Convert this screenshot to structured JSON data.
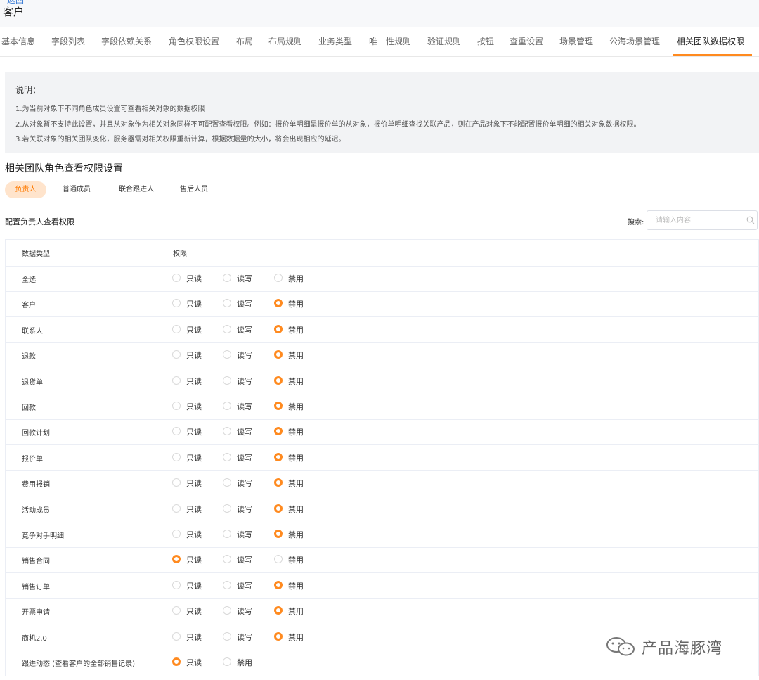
{
  "header": {
    "breadcrumb": "返回",
    "title": "客户"
  },
  "tabs": [
    "基本信息",
    "字段列表",
    "字段依赖关系",
    "角色权限设置",
    "布局",
    "布局规则",
    "业务类型",
    "唯一性规则",
    "验证规则",
    "按钮",
    "查重设置",
    "场景管理",
    "公海场景管理",
    "相关团队数据权限"
  ],
  "active_tab": "相关团队数据权限",
  "note": {
    "title": "说明：",
    "lines": [
      "1.为当前对象下不同角色成员设置可查看相关对象的数据权限",
      "2.从对象暂不支持此设置，并且从对象作为相关对象同样不可配置查看权限。例如：报价单明细是报价单的从对象，报价单明细查找关联产品，则在产品对象下不能配置报价单明细的相关对象数据权限。",
      "3.若关联对象的相关团队变化，服务器需对相关权限重新计算，根据数据量的大小，将会出现相应的延迟。"
    ]
  },
  "section_title": "相关团队角色查看权限设置",
  "role_tabs": [
    "负责人",
    "普通成员",
    "联合跟进人",
    "售后人员"
  ],
  "active_role": "负责人",
  "config_title": "配置负责人查看权限",
  "search": {
    "label": "搜索:",
    "placeholder": "请输入内容"
  },
  "table": {
    "headers": [
      "数据类型",
      "权限"
    ],
    "rows": [
      {
        "name": "全选",
        "options": [
          "只读",
          "读写",
          "禁用"
        ],
        "selected": null
      },
      {
        "name": "客户",
        "options": [
          "只读",
          "读写",
          "禁用"
        ],
        "selected": "禁用"
      },
      {
        "name": "联系人",
        "options": [
          "只读",
          "读写",
          "禁用"
        ],
        "selected": "禁用"
      },
      {
        "name": "退款",
        "options": [
          "只读",
          "读写",
          "禁用"
        ],
        "selected": "禁用"
      },
      {
        "name": "退货单",
        "options": [
          "只读",
          "读写",
          "禁用"
        ],
        "selected": "禁用"
      },
      {
        "name": "回款",
        "options": [
          "只读",
          "读写",
          "禁用"
        ],
        "selected": "禁用"
      },
      {
        "name": "回款计划",
        "options": [
          "只读",
          "读写",
          "禁用"
        ],
        "selected": "禁用"
      },
      {
        "name": "报价单",
        "options": [
          "只读",
          "读写",
          "禁用"
        ],
        "selected": "禁用"
      },
      {
        "name": "费用报销",
        "options": [
          "只读",
          "读写",
          "禁用"
        ],
        "selected": "禁用"
      },
      {
        "name": "活动成员",
        "options": [
          "只读",
          "读写",
          "禁用"
        ],
        "selected": "禁用"
      },
      {
        "name": "竞争对手明细",
        "options": [
          "只读",
          "读写",
          "禁用"
        ],
        "selected": "禁用"
      },
      {
        "name": "销售合同",
        "options": [
          "只读",
          "读写",
          "禁用"
        ],
        "selected": "只读"
      },
      {
        "name": "销售订单",
        "options": [
          "只读",
          "读写",
          "禁用"
        ],
        "selected": "禁用"
      },
      {
        "name": "开票申请",
        "options": [
          "只读",
          "读写",
          "禁用"
        ],
        "selected": "禁用"
      },
      {
        "name": "商机2.0",
        "options": [
          "只读",
          "读写",
          "禁用"
        ],
        "selected": "禁用"
      },
      {
        "name": "跟进动态 (查看客户的全部销售记录)",
        "options": [
          "只读",
          "禁用"
        ],
        "selected": "只读"
      }
    ]
  },
  "watermark": {
    "text": "产品海豚湾"
  },
  "colors": {
    "accent": "#ff8a1f",
    "active_role_bg": "#ffe4cc",
    "note_bg": "#f2f3f5"
  }
}
